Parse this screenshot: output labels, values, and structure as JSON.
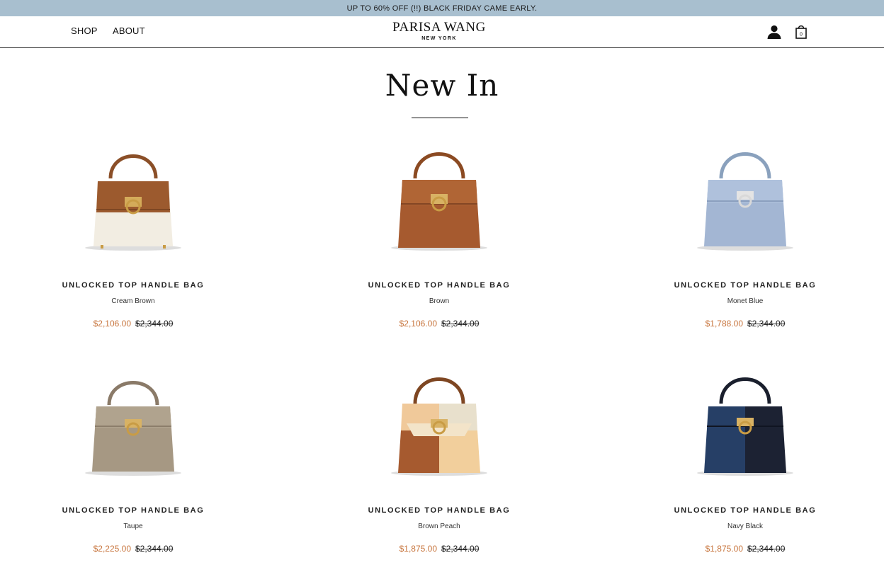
{
  "announcement": "UP TO 60% OFF (!!) BLACK FRIDAY CAME EARLY.",
  "nav": {
    "shop": "SHOP",
    "about": "ABOUT"
  },
  "logo": {
    "main": "PARISA WANG",
    "sub": "NEW YORK"
  },
  "icons": {
    "account": "account-icon",
    "cart": "shopping-bag-icon",
    "cart_count": "0"
  },
  "page_title": "New In",
  "products": [
    {
      "name": "UNLOCKED TOP HANDLE BAG",
      "color": "Cream Brown",
      "sale_price": "$2,106.00",
      "original_price": "$2,344.00"
    },
    {
      "name": "UNLOCKED TOP HANDLE BAG",
      "color": "Brown",
      "sale_price": "$2,106.00",
      "original_price": "$2,344.00"
    },
    {
      "name": "UNLOCKED TOP HANDLE BAG",
      "color": "Monet Blue",
      "sale_price": "$1,788.00",
      "original_price": "$2,344.00"
    },
    {
      "name": "UNLOCKED TOP HANDLE BAG",
      "color": "Taupe",
      "sale_price": "$2,225.00",
      "original_price": "$2,344.00"
    },
    {
      "name": "UNLOCKED TOP HANDLE BAG",
      "color": "Brown Peach",
      "sale_price": "$1,875.00",
      "original_price": "$2,344.00"
    },
    {
      "name": "UNLOCKED TOP HANDLE BAG",
      "color": "Navy Black",
      "sale_price": "$1,875.00",
      "original_price": "$2,344.00"
    }
  ],
  "colors": {
    "announce_bg": "#a8bfcf",
    "sale_price": "#c8763f"
  }
}
